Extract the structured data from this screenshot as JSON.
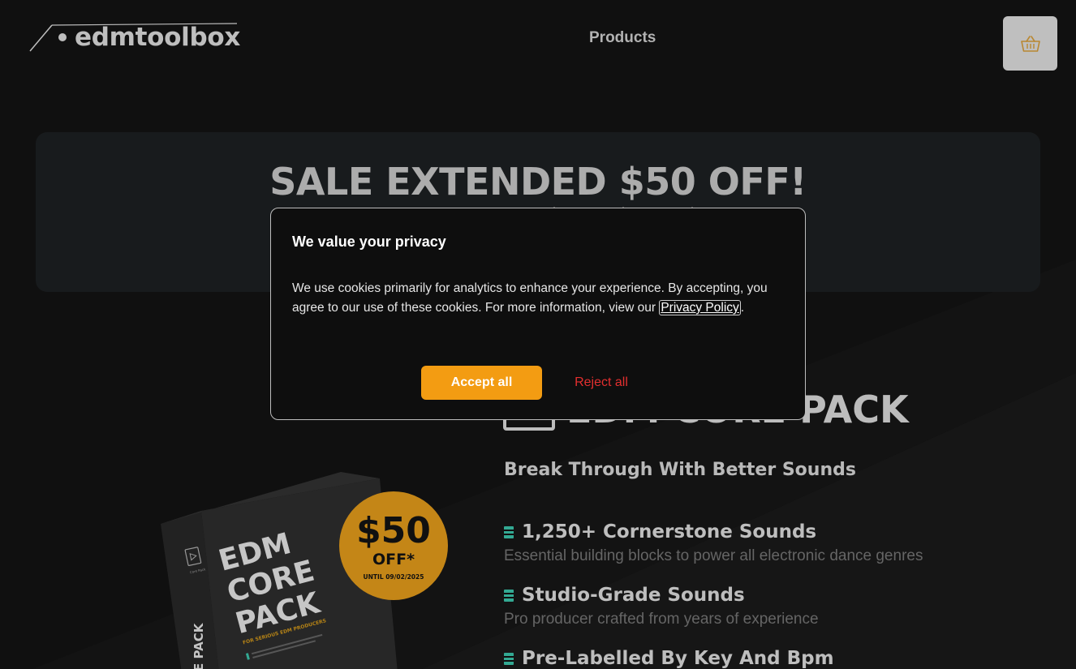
{
  "header": {
    "logo_text": "edmtoolbox",
    "nav_products": "Products",
    "cart_icon": "basket-icon"
  },
  "banner": {
    "title": "SALE EXTENDED $50 OFF!"
  },
  "cookie_modal": {
    "title": "We value your privacy",
    "text_before_link": "We use cookies primarily for analytics to enhance your experience. By accepting, you agree to our use of these cookies. For more information, view our ",
    "link_text": "Privacy Policy",
    "text_after_link": ".",
    "accept_label": "Accept all",
    "reject_label": "Reject all"
  },
  "product": {
    "title": "EDM CORE PACK",
    "tagline": "Break Through With Better Sounds",
    "features": [
      {
        "title": "1,250+ Cornerstone Sounds",
        "desc": "Essential building blocks to power all electronic dance genres"
      },
      {
        "title": "Studio-Grade Sounds",
        "desc": "Pro producer crafted from years of experience"
      },
      {
        "title": "Pre-Labelled By Key And Bpm",
        "desc": ""
      }
    ],
    "box_art": {
      "line1": "EDM",
      "line2": "CORE",
      "line3": "PACK",
      "subtitle": "FOR SERIOUS EDM PRODUCERS",
      "spine": "E PACK",
      "logo_caption": "Core Pack"
    },
    "badge": {
      "amount": "$50",
      "off": "OFF*",
      "until": "UNTIL 09/02/2025"
    }
  },
  "colors": {
    "accent": "#f39c12",
    "badge": "#f0a41d",
    "reject": "#e32f2f",
    "bullet": "#3fcfb4",
    "background": "#141414"
  }
}
